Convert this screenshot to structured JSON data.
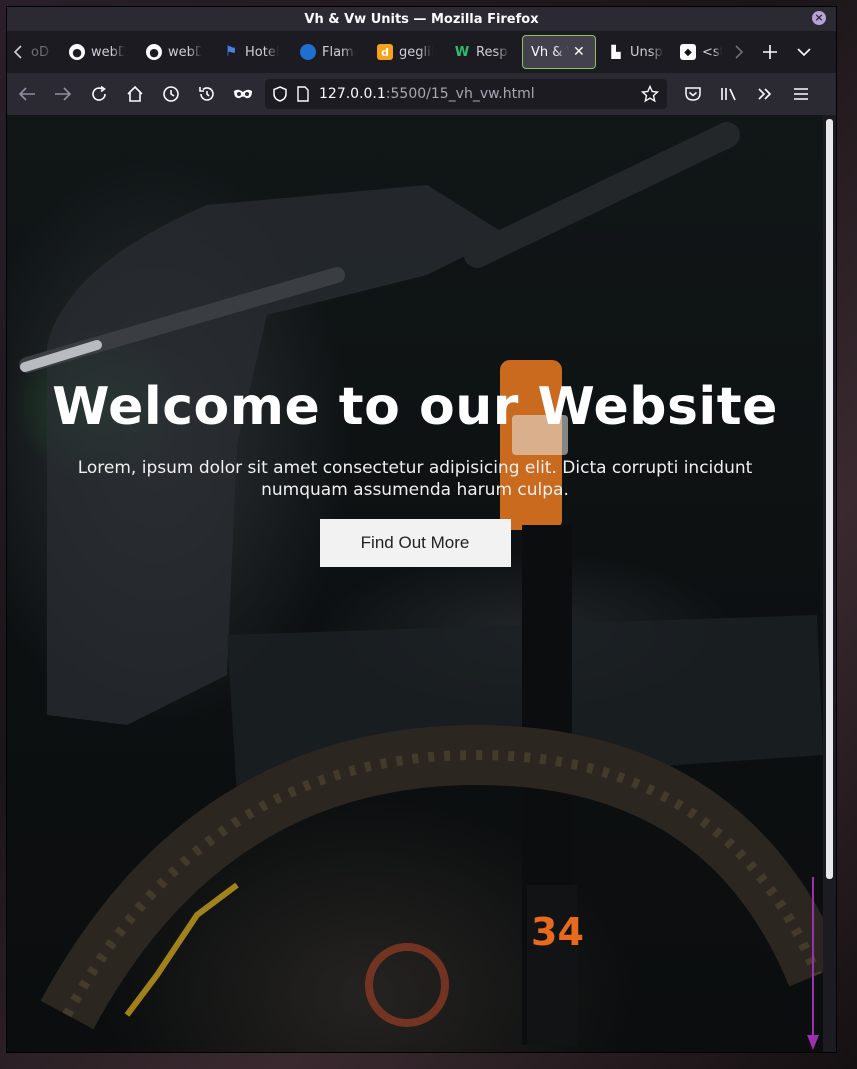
{
  "window": {
    "title": "Vh & Vw Units — Mozilla Firefox"
  },
  "tabs": [
    {
      "label": "oD",
      "icon": "tab-overflow-icon"
    },
    {
      "label": "webD",
      "icon": "github-icon"
    },
    {
      "label": "webD",
      "icon": "github-icon"
    },
    {
      "label": "Hotel",
      "icon": "flag-icon"
    },
    {
      "label": "Flame",
      "icon": "flame-icon"
    },
    {
      "label": "geglik",
      "icon": "d-icon"
    },
    {
      "label": "Resp",
      "icon": "w-icon"
    },
    {
      "label": "Vh & V",
      "icon": "",
      "active": true
    },
    {
      "label": "Unspl",
      "icon": "unsplash-icon"
    },
    {
      "label": "<sty",
      "icon": "dog-icon"
    }
  ],
  "url": {
    "host": "127.0.0.1",
    "path": ":5500/15_vh_vw.html"
  },
  "hero": {
    "title": "Welcome to our Website",
    "text": "Lorem, ipsum dolor sit amet consectetur adipisicing elit. Dicta corrupti incidunt numquam assumenda harum culpa.",
    "button": "Find Out More"
  },
  "colors": {
    "accent": "#8fc25a",
    "chrome": "#2b2a33",
    "scroll_arrow": "#9b2fae"
  }
}
